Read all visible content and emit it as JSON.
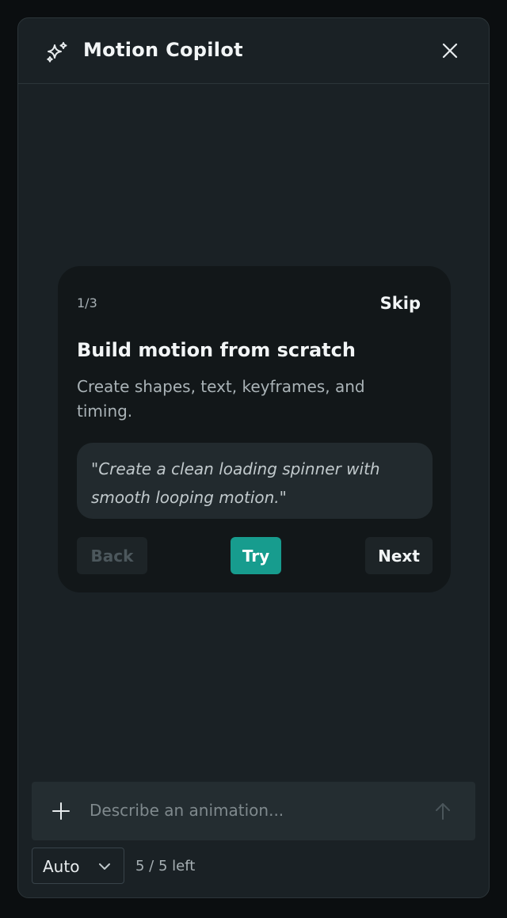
{
  "header": {
    "icon": "sparkles-icon",
    "title": "Motion Copilot",
    "close_icon": "close-icon"
  },
  "onboarding": {
    "step": "1/3",
    "skip_label": "Skip",
    "title": "Build motion from scratch",
    "description": "Create shapes, text, keyframes, and timing.",
    "example_prompt": "\"Create a clean loading spinner with smooth looping motion.\"",
    "back_label": "Back",
    "try_label": "Try",
    "next_label": "Next",
    "accent_color": "#179c8e"
  },
  "composer": {
    "add_icon": "plus-icon",
    "placeholder": "Describe an animation...",
    "value": "",
    "send_icon": "arrow-up-icon"
  },
  "footer": {
    "model_value": "Auto",
    "model_icon": "chevron-down-icon",
    "quota": "5 / 5 left"
  }
}
